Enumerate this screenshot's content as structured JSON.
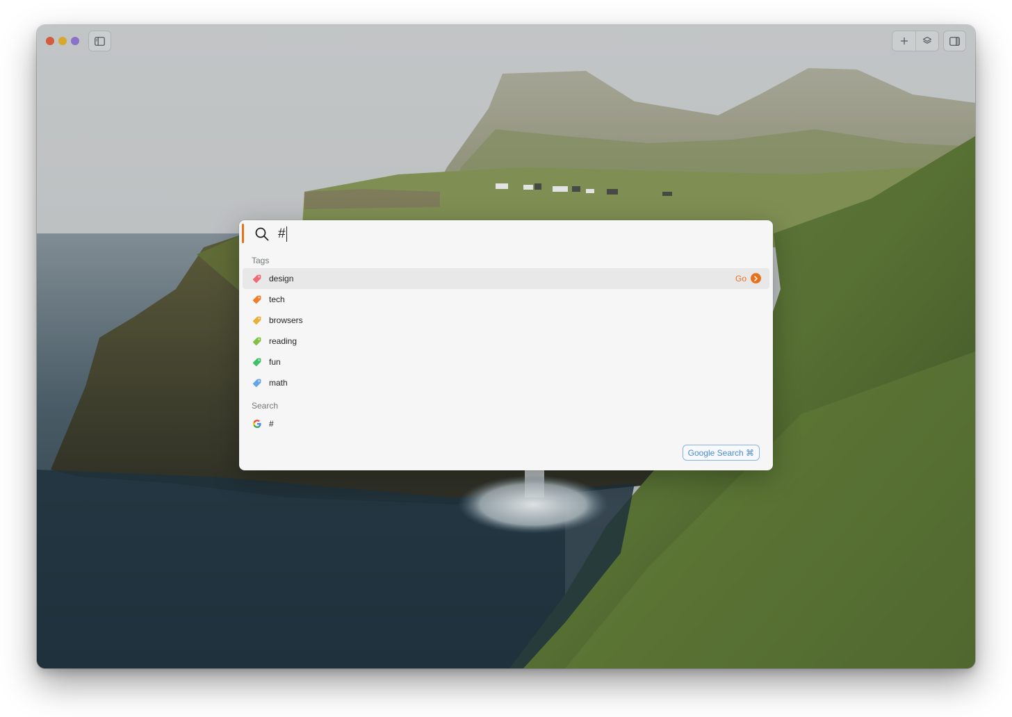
{
  "window": {
    "colors": {
      "close": "#d35b3e",
      "minimize": "#d8a72d",
      "maximize": "#8a72c9"
    },
    "toolbar_icons": [
      "sidebar-left-icon",
      "plus-icon",
      "layers-icon",
      "sidebar-right-icon"
    ]
  },
  "palette": {
    "query": "#",
    "accent_color": "#e8711c",
    "sections": {
      "tags_label": "Tags",
      "search_label": "Search"
    },
    "tags": [
      {
        "label": "design",
        "color": "#f06a73"
      },
      {
        "label": "tech",
        "color": "#f07c2c"
      },
      {
        "label": "browsers",
        "color": "#e6b13a"
      },
      {
        "label": "reading",
        "color": "#82c142"
      },
      {
        "label": "fun",
        "color": "#3cc169"
      },
      {
        "label": "math",
        "color": "#66a4e8"
      }
    ],
    "selected_action": "Go",
    "search_results": [
      {
        "label": "#",
        "icon": "google-icon"
      }
    ],
    "footer_button": "Google Search ⌘"
  }
}
